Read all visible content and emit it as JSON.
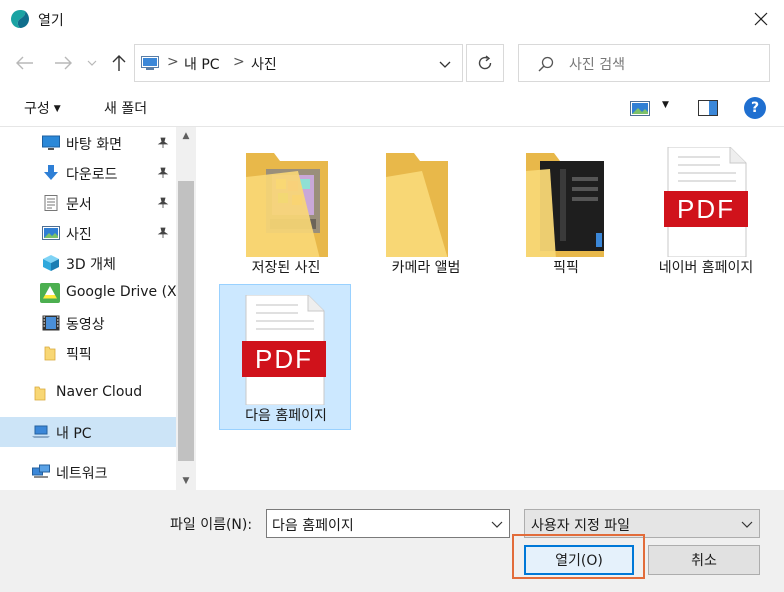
{
  "window": {
    "title": "열기",
    "close_symbol": "✕"
  },
  "address_bar": {
    "crumbs": [
      "내 PC",
      "사진"
    ]
  },
  "search": {
    "placeholder": "사진 검색"
  },
  "toolbar": {
    "organize_label": "구성",
    "new_folder_label": "새 폴더",
    "help_symbol": "?"
  },
  "sidebar": {
    "items": [
      {
        "label": "바탕 화면",
        "icon": "desktop-icon",
        "pinned": true
      },
      {
        "label": "다운로드",
        "icon": "download-icon",
        "pinned": true
      },
      {
        "label": "문서",
        "icon": "document-icon",
        "pinned": true
      },
      {
        "label": "사진",
        "icon": "pictures-icon",
        "pinned": true
      },
      {
        "label": "3D 개체",
        "icon": "3d-objects-icon",
        "pinned": false
      },
      {
        "label": "Google Drive (X",
        "icon": "google-drive-icon",
        "pinned": false
      },
      {
        "label": "동영상",
        "icon": "videos-icon",
        "pinned": false
      },
      {
        "label": "픽픽",
        "icon": "folder-icon",
        "pinned": false
      },
      {
        "label": "Naver Cloud",
        "icon": "folder-icon",
        "pinned": false
      },
      {
        "label": "내 PC",
        "icon": "this-pc-icon",
        "pinned": false,
        "selected": true
      },
      {
        "label": "네트워크",
        "icon": "network-icon",
        "pinned": false
      }
    ]
  },
  "files": [
    {
      "name": "저장된 사진",
      "icon": "folder-photos-icon"
    },
    {
      "name": "카메라 앨범",
      "icon": "folder-icon"
    },
    {
      "name": "픽픽",
      "icon": "folder-dark-icon"
    },
    {
      "name": "네이버 홈페이지",
      "icon": "pdf-file-icon",
      "badge": "PDF"
    },
    {
      "name": "다음 홈페이지",
      "icon": "pdf-file-icon",
      "badge": "PDF",
      "selected": true
    }
  ],
  "bottom": {
    "filename_label": "파일 이름(N):",
    "filename_value": "다음 홈페이지",
    "filetype_value": "사용자 지정 파일",
    "open_button": "열기(O)",
    "cancel_button": "취소"
  },
  "colors": {
    "accent": "#0078d7",
    "selection": "#cce8ff",
    "highlight_outline": "#e26c3a",
    "pdf_red": "#d0121b",
    "folder_yellow": "#f8d775"
  }
}
